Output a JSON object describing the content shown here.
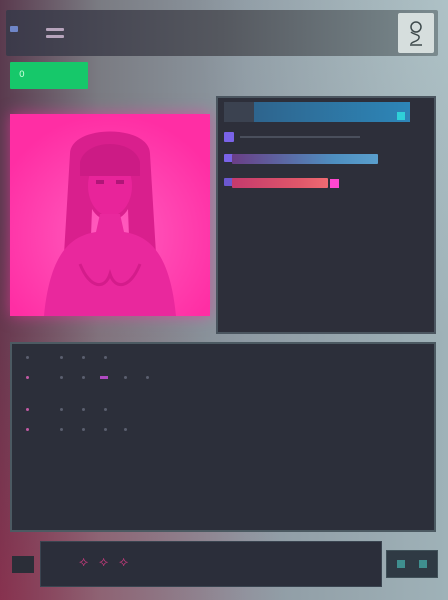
{
  "topbar": {
    "menu_icon": "hamburger-icon",
    "profile_icon": "profile-sketch-icon"
  },
  "badge": {
    "label": "0",
    "color": "#16c86a"
  },
  "media": {
    "icon": "portrait-image",
    "accent_color": "#ff2ea4"
  },
  "panel": {
    "header_color": "#2d86b8",
    "bar_colors": [
      "#4e8fc0",
      "#e0576a"
    ]
  },
  "footer": {
    "glyphs": [
      "⟡",
      "⟡",
      "⟡"
    ]
  },
  "colors": {
    "background": "#8e9aa3",
    "dark_panel": "#2c2f3a",
    "pink": "#ff2ea4",
    "green": "#16c86a",
    "violet": "#7a63e8"
  }
}
